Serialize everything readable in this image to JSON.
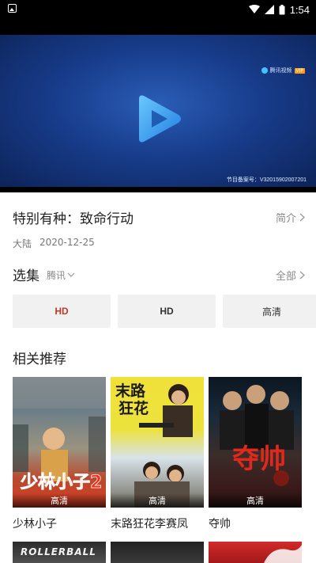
{
  "status_bar": {
    "time": "1:54"
  },
  "player": {
    "logo_text": "腾讯视频",
    "logo_badge": "VIP",
    "record_number": "节目备案号：V32015902007201"
  },
  "video": {
    "title": "特别有种：致命行动",
    "intro_label": "简介",
    "region": "大陆",
    "date": "2020-12-25"
  },
  "episodes": {
    "heading": "选集",
    "source": "腾讯",
    "all_label": "全部",
    "items": [
      {
        "label": "HD",
        "active": true
      },
      {
        "label": "HD",
        "active": false
      },
      {
        "label": "高清",
        "active": false
      }
    ]
  },
  "recommend": {
    "heading": "相关推荐",
    "items": [
      {
        "name": "少林小子",
        "tag": "高清",
        "poster_text": "少林小子2"
      },
      {
        "name": "末路狂花李赛凤",
        "tag": "高清",
        "poster_text": "末路\n狂花"
      },
      {
        "name": "夺帅",
        "tag": "高清",
        "poster_text": "夺帅"
      }
    ],
    "next_row_poster_text": "ROLLERBALL"
  },
  "colors": {
    "accent": "#c0392b",
    "player_blue": "#1c4aa0",
    "play_icon": "#3aa3f0"
  }
}
